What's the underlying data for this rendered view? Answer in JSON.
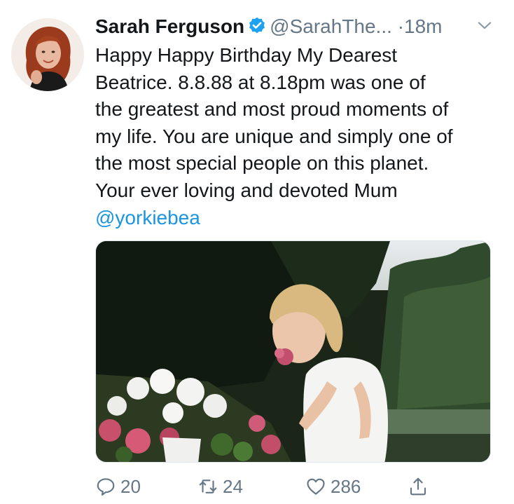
{
  "tweet": {
    "author": {
      "display_name": "Sarah Ferguson",
      "handle": "@SarahThe...",
      "verified": true
    },
    "separator": "·",
    "timestamp": "18m",
    "text_lines": [
      "Happy Happy Birthday My Dearest",
      "Beatrice. 8.8.88 at 8.18pm was one of",
      "the greatest and most proud moments of",
      "my life. You are unique and simply one of",
      "the most special people on this planet.",
      "Your ever loving and devoted Mum"
    ],
    "mention": "@yorkiebea",
    "actions": {
      "replies": "20",
      "retweets": "24",
      "likes": "286"
    }
  },
  "icons": {
    "verified": "verified-badge-icon",
    "more": "chevron-down-icon",
    "reply": "reply-icon",
    "retweet": "retweet-icon",
    "like": "heart-icon",
    "share": "share-icon"
  },
  "colors": {
    "text": "#14171a",
    "secondary": "#657786",
    "link": "#1b95e0",
    "verified": "#1da1f2"
  }
}
